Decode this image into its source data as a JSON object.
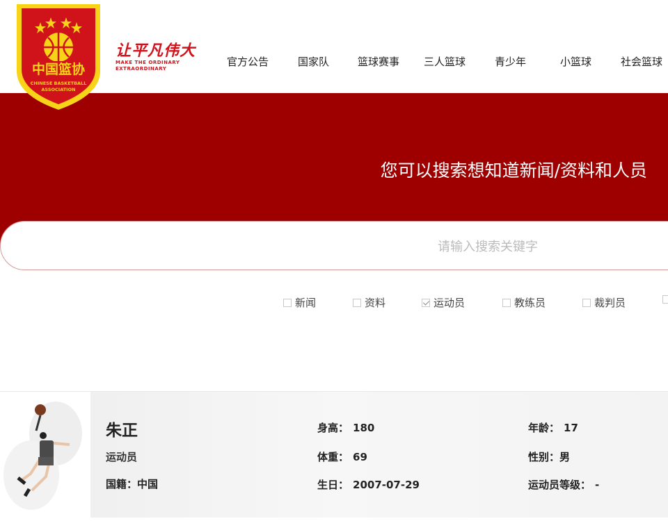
{
  "logo": {
    "cn_text": "中国篮协",
    "en_line1": "CHINESE BASKETBALL",
    "en_line2": "ASSOCIATION"
  },
  "slogan": {
    "cn": "让平凡伟大",
    "en_line1": "MAKE THE ORDINARY",
    "en_line2": "EXTRAORDINARY"
  },
  "nav": [
    {
      "label": "官方公告"
    },
    {
      "label": "国家队"
    },
    {
      "label": "篮球赛事"
    },
    {
      "label": "三人篮球"
    },
    {
      "label": "青少年"
    },
    {
      "label": "小篮球"
    },
    {
      "label": "社会篮球"
    }
  ],
  "banner": {
    "title": "您可以搜索想知道新闻/资料和人员"
  },
  "search": {
    "placeholder": "请输入搜索关键字"
  },
  "filters": [
    {
      "label": "新闻",
      "checked": false
    },
    {
      "label": "资料",
      "checked": false
    },
    {
      "label": "运动员",
      "checked": true
    },
    {
      "label": "教练员",
      "checked": false
    },
    {
      "label": "裁判员",
      "checked": false
    }
  ],
  "result": {
    "name": "朱正",
    "role": "运动员",
    "nationality_label": "国籍：",
    "nationality": "中国",
    "height_label": "身高：",
    "height": "180",
    "weight_label": "体重：",
    "weight": "69",
    "birthday_label": "生日：",
    "birthday": "2007-07-29",
    "age_label": "年龄：",
    "age": "17",
    "gender_label": "性别：",
    "gender": "男",
    "level_label": "运动员等级：",
    "level": "-"
  },
  "colors": {
    "brand_red": "#9e0000",
    "logo_red": "#d0121b",
    "logo_yellow": "#f7d417"
  }
}
